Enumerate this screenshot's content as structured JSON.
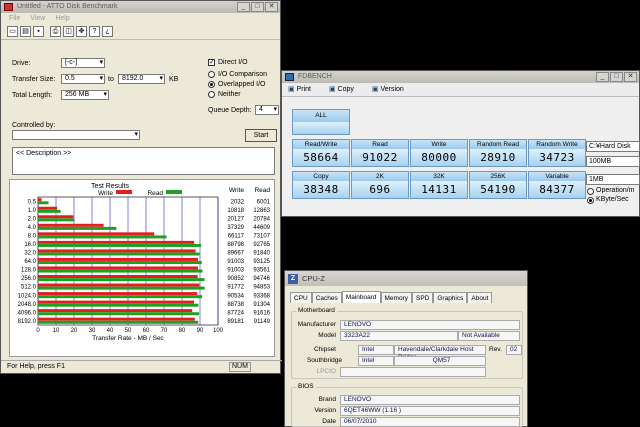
{
  "atto": {
    "title": "Untitled - ATTO Disk Benchmark",
    "menu": [
      "File",
      "View",
      "Help"
    ],
    "drive_label": "Drive:",
    "drive_value": "[-c-]",
    "transfer_size_label": "Transfer Size:",
    "transfer_from": "0.5",
    "transfer_to_label": "to",
    "transfer_to": "8192.0",
    "transfer_unit": "KB",
    "total_length_label": "Total Length:",
    "total_length_value": "256 MB",
    "direct_io_label": "Direct I/O",
    "direct_io_checked": "✓",
    "io_comparison_label": "I/O Comparison",
    "overlapped_io_label": "Overlapped I/O",
    "neither_label": "Neither",
    "queue_depth_label": "Queue Depth:",
    "queue_depth_value": "4",
    "controlled_by_label": "Controlled by:",
    "start_label": "Start",
    "description_text": "<< Description >>",
    "results_title": "Test Results",
    "write_legend": "Write",
    "read_legend": "Read",
    "write_col": "Write",
    "read_col": "Read",
    "xlabel": "Transfer Rate - MB / Sec",
    "status_text": "For Help, press F1",
    "status_num": "NUM",
    "write_color": "#e02020",
    "read_color": "#20a020"
  },
  "chart_data": {
    "type": "bar",
    "title": "Test Results",
    "xlabel": "Transfer Rate - MB / Sec",
    "categories": [
      "0.5",
      "1.0",
      "2.0",
      "4.0",
      "8.0",
      "16.0",
      "32.0",
      "64.0",
      "128.0",
      "256.0",
      "512.0",
      "1024.0",
      "2048.0",
      "4096.0",
      "8192.0"
    ],
    "series": [
      {
        "name": "Write",
        "values": [
          2032,
          10818,
          20127,
          37329,
          66117,
          88798,
          89667,
          91003,
          91003,
          90852,
          91772,
          90534,
          88738,
          87724,
          89181
        ]
      },
      {
        "name": "Read",
        "values": [
          6001,
          12863,
          20784,
          44609,
          73107,
          92765,
          91840,
          93125,
          93561,
          94746,
          94853,
          93368,
          91304,
          91616,
          91149
        ]
      }
    ],
    "x_ticks": [
      "0",
      "10",
      "20",
      "30",
      "40",
      "50",
      "60",
      "70",
      "80",
      "90",
      "100"
    ],
    "xlim": [
      0,
      100
    ],
    "unit_note": "values in KB/s; bars in MB/s"
  },
  "fdbench": {
    "title": "FDBENCH",
    "toolbar": [
      "Print",
      "Copy",
      "Version"
    ],
    "all_label": "ALL",
    "row1": [
      {
        "label": "Read/Write",
        "value": "58664"
      },
      {
        "label": "Read",
        "value": "91022"
      },
      {
        "label": "Write",
        "value": "80000"
      },
      {
        "label": "Random Read",
        "value": "28910"
      },
      {
        "label": "Random Write",
        "value": "34723"
      }
    ],
    "row2": [
      {
        "label": "Copy",
        "value": "38348"
      },
      {
        "label": "2K",
        "value": "696"
      },
      {
        "label": "32K",
        "value": "14131"
      },
      {
        "label": "256K",
        "value": "54190"
      },
      {
        "label": "Variable",
        "value": "84377"
      }
    ],
    "drive": "C:¥Hard Disk",
    "size": "100MB",
    "block": "1MB",
    "opt1": "Operation/m",
    "opt2": "KByte/Sec"
  },
  "cpuz": {
    "title": "CPU-Z",
    "tabs": [
      "CPU",
      "Caches",
      "Mainboard",
      "Memory",
      "SPD",
      "Graphics",
      "About"
    ],
    "mb_group": "Motherboard",
    "manufacturer_label": "Manufacturer",
    "manufacturer": "LENOVO",
    "model_label": "Model",
    "model": "3323A22",
    "model_extra": "Not Available",
    "chipset_label": "Chipset",
    "chipset_vendor": "Intel",
    "chipset_name": "Havendale/Clarkdale Host Bridge",
    "rev_label": "Rev.",
    "rev": "02",
    "southbridge_label": "Southbridge",
    "sb_vendor": "Intel",
    "sb_name": "QM57",
    "lpcio_label": "LPCIO",
    "bios_group": "BIOS",
    "brand_label": "Brand",
    "brand": "LENOVO",
    "version_label": "Version",
    "version": "6QET46WW (1.16 )",
    "date_label": "Date",
    "date": "06/07/2010"
  }
}
